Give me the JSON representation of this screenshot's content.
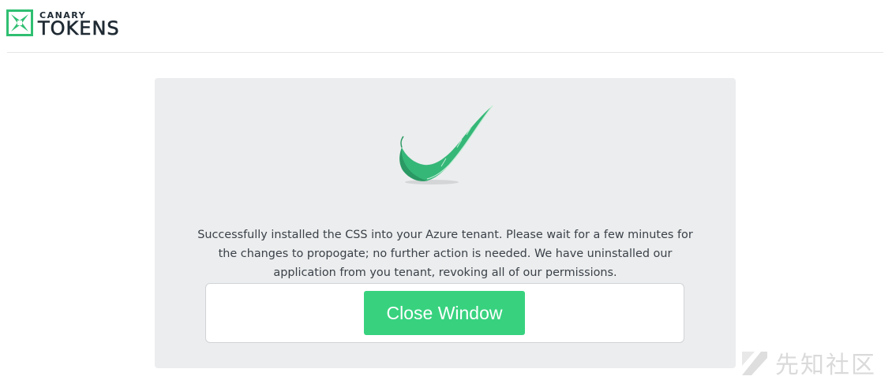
{
  "header": {
    "logo": {
      "small_text": "CANARY",
      "big_text": "TOKENS",
      "icon": "canary-logo-icon"
    }
  },
  "panel": {
    "success_icon": "feather-checkmark-icon",
    "message": "Successfully installed the CSS into your Azure tenant. Please wait for a few minutes for the changes to propogate; no further action is needed. We have uninstalled our application from you tenant, revoking all of our permissions.",
    "close_button_label": "Close Window"
  },
  "watermark": {
    "icon": "xianzhi-logo-icon",
    "text": "先知社区"
  },
  "colors": {
    "brand_green": "#38d27f",
    "logo_green": "#2fbf71",
    "panel_bg": "#ecedee",
    "text": "#3a4148"
  }
}
